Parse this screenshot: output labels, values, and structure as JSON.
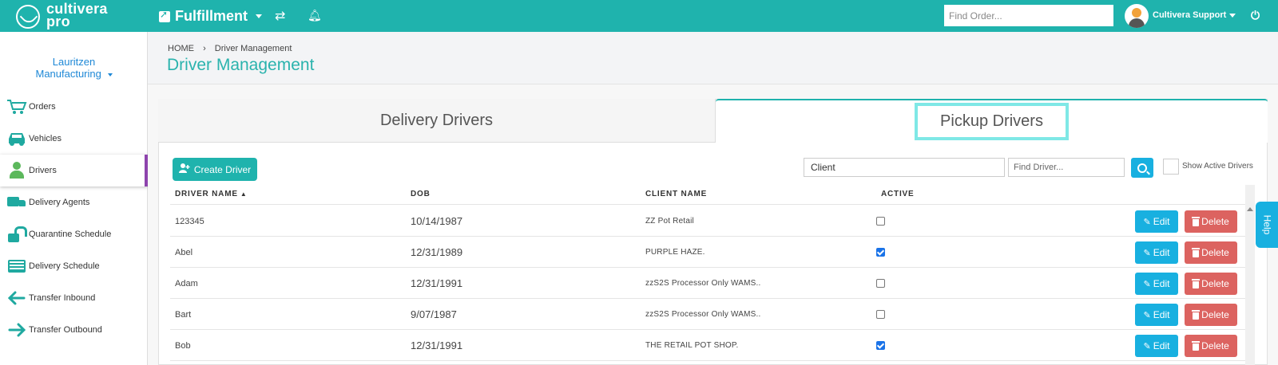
{
  "header": {
    "logo_line1": "cultivera",
    "logo_line2": "pro",
    "module": "Fulfillment",
    "find_order_placeholder": "Find Order...",
    "user_name": "Cultivera Support",
    "accent_color": "#1fb3ad"
  },
  "sidebar": {
    "company_line1": "Lauritzen",
    "company_line2": "Manufacturing",
    "items": [
      {
        "label": "Orders",
        "icon": "cart-icon"
      },
      {
        "label": "Vehicles",
        "icon": "car-icon"
      },
      {
        "label": "Drivers",
        "icon": "person-icon",
        "active": true
      },
      {
        "label": "Delivery Agents",
        "icon": "truck-icon"
      },
      {
        "label": "Quarantine Schedule",
        "icon": "unlock-icon"
      },
      {
        "label": "Delivery Schedule",
        "icon": "list-icon"
      },
      {
        "label": "Transfer Inbound",
        "icon": "arrow-left-icon"
      },
      {
        "label": "Transfer Outbound",
        "icon": "arrow-right-icon"
      }
    ]
  },
  "breadcrumb": {
    "home": "HOME",
    "sep": "›",
    "current": "Driver Management"
  },
  "page_title": "Driver Management",
  "tabs": {
    "delivery": "Delivery Drivers",
    "pickup": "Pickup Drivers",
    "selected": "pickup"
  },
  "toolbar": {
    "create_label": "Create Driver",
    "client_value": "Client",
    "find_driver_placeholder": "Find Driver...",
    "show_active_label": "Show Active Drivers",
    "show_active_checked": false
  },
  "table": {
    "headers": {
      "name": "DRIVER NAME",
      "dob": "DOB",
      "client": "CLIENT NAME",
      "active": "ACTIVE"
    },
    "sort_indicator": "▲",
    "edit_label": "Edit",
    "delete_label": "Delete",
    "rows": [
      {
        "name": "123345",
        "dob": "10/14/1987",
        "client": "ZZ Pot Retail",
        "active": false
      },
      {
        "name": "Abel",
        "dob": "12/31/1989",
        "client": "PURPLE HAZE.",
        "active": true
      },
      {
        "name": "Adam",
        "dob": "12/31/1991",
        "client": "zzS2S Processor Only WAMS..",
        "active": false
      },
      {
        "name": "Bart",
        "dob": "9/07/1987",
        "client": "zzS2S Processor Only WAMS..",
        "active": false
      },
      {
        "name": "Bob",
        "dob": "12/31/1991",
        "client": "THE RETAIL POT SHOP.",
        "active": true
      }
    ]
  },
  "help_label": "Help"
}
